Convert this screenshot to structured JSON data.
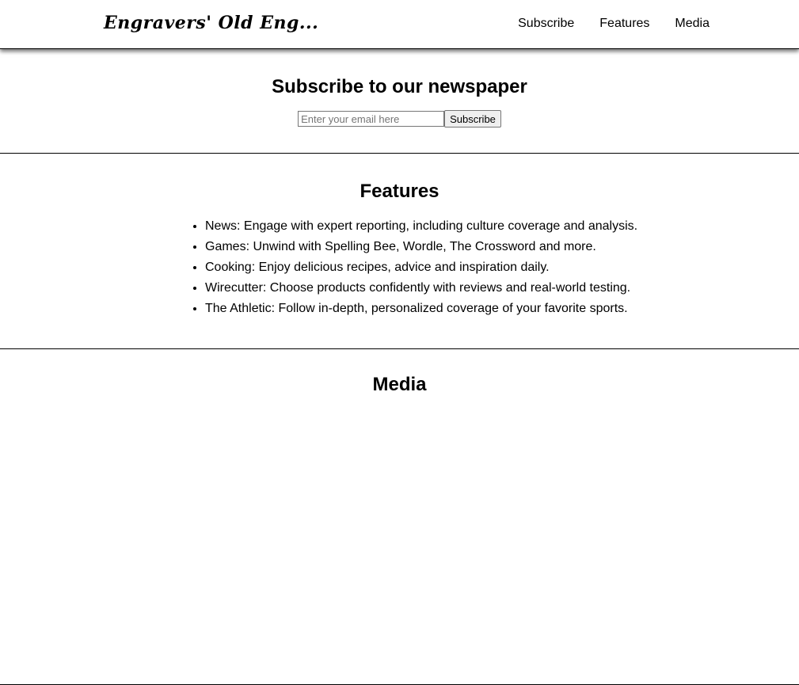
{
  "header": {
    "logo": "Engravers' Old Eng...",
    "nav": [
      "Subscribe",
      "Features",
      "Media"
    ]
  },
  "subscribe": {
    "title": "Subscribe to our newspaper",
    "email_placeholder": "Enter your email here",
    "button_label": "Subscribe"
  },
  "features": {
    "title": "Features",
    "items": [
      "News: Engage with expert reporting, including culture coverage and analysis.",
      "Games: Unwind with Spelling Bee, Wordle, The Crossword and more.",
      "Cooking: Enjoy delicious recipes, advice and inspiration daily.",
      "Wirecutter: Choose products confidently with reviews and real-world testing.",
      "The Athletic: Follow in-depth, personalized coverage of your favorite sports."
    ]
  },
  "media": {
    "title": "Media"
  }
}
